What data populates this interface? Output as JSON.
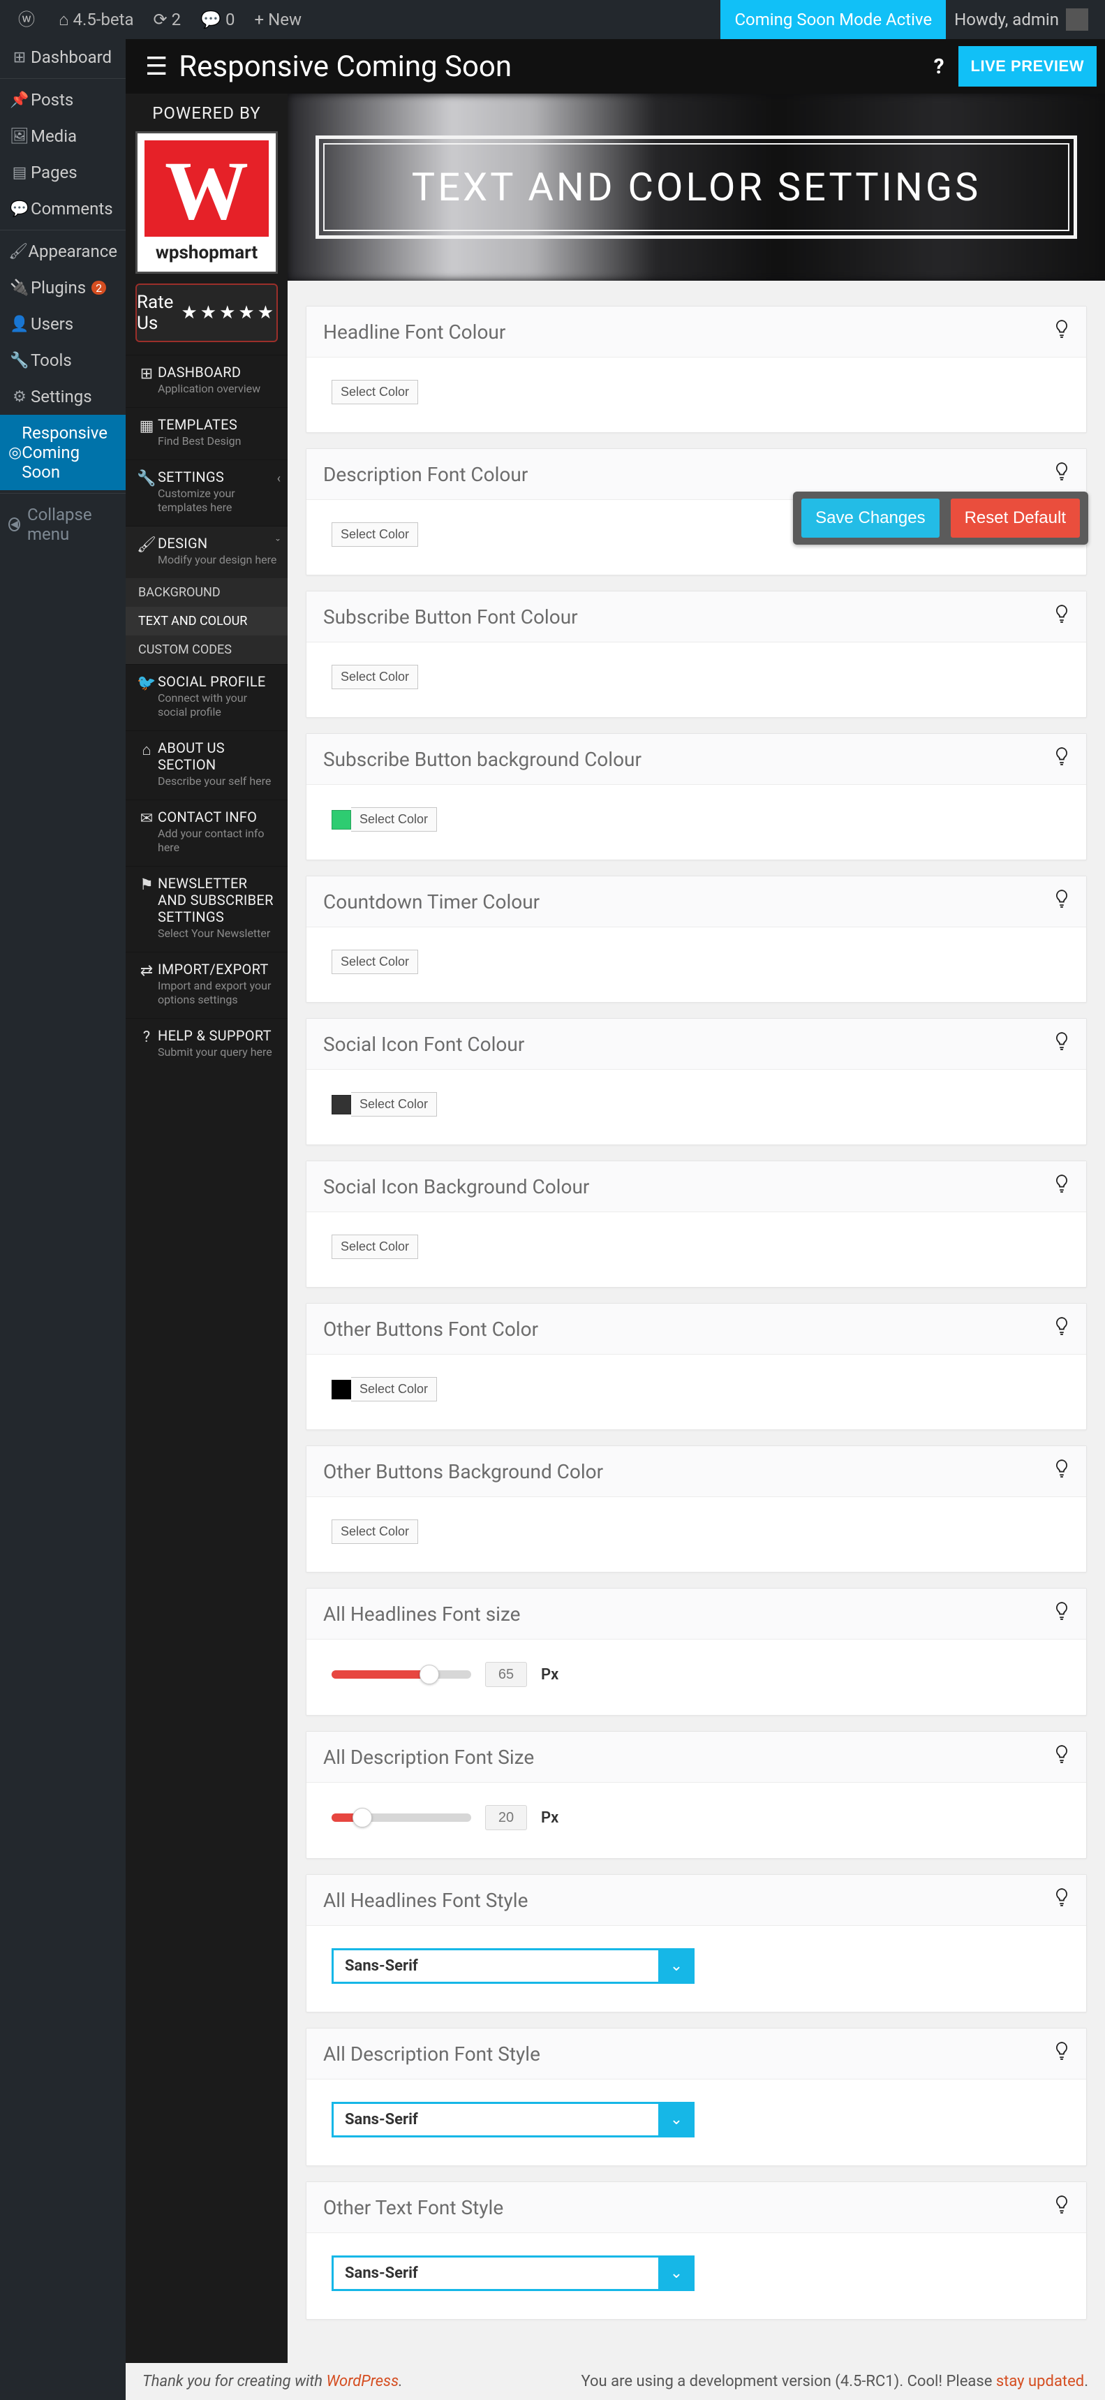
{
  "adminbar": {
    "site_name": "4.5-beta",
    "updates": "2",
    "comments": "0",
    "new": "New",
    "coming_soon": "Coming Soon Mode Active",
    "howdy": "Howdy, admin"
  },
  "wp_menu": {
    "dashboard": "Dashboard",
    "posts": "Posts",
    "media": "Media",
    "pages": "Pages",
    "comments": "Comments",
    "appearance": "Appearance",
    "plugins": "Plugins",
    "plugins_count": "2",
    "users": "Users",
    "tools": "Tools",
    "settings": "Settings",
    "rcs": "Responsive Coming Soon",
    "collapse": "Collapse menu"
  },
  "plugin": {
    "title": "Responsive Coming Soon",
    "preview_btn": "LIVE PREVIEW",
    "powered_by": "POWERED BY",
    "brand": "wpshopmart",
    "rate_us": "Rate Us",
    "hero_title": "TEXT AND COLOR SETTINGS",
    "save": "Save Changes",
    "reset": "Reset Default"
  },
  "plugin_menu": {
    "dashboard": {
      "t": "DASHBOARD",
      "s": "Application overview"
    },
    "templates": {
      "t": "TEMPLATES",
      "s": "Find Best Design"
    },
    "settings": {
      "t": "SETTINGS",
      "s": "Customize your templates here"
    },
    "design": {
      "t": "DESIGN",
      "s": "Modify your design here"
    },
    "design_title": "DESIGN",
    "design_sub1": "BACKGROUND",
    "design_sub2": "TEXT AND COLOUR",
    "design_sub3": "CUSTOM CODES",
    "social": {
      "t": "SOCIAL PROFILE",
      "s": "Connect with your social profile"
    },
    "about": {
      "t": "ABOUT US SECTION",
      "s": "Describe your self here"
    },
    "contact": {
      "t": "CONTACT INFO",
      "s": "Add your contact info here"
    },
    "newsletter": {
      "t": "NEWSLETTER AND SUBSCRIBER SETTINGS",
      "s": "Select Your Newsletter"
    },
    "import": {
      "t": "IMPORT/EXPORT",
      "s": "Import and export your options settings"
    },
    "help": {
      "t": "HELP & SUPPORT",
      "s": "Submit your query here"
    }
  },
  "cards": [
    {
      "label": "Headline Font Colour",
      "type": "color",
      "swatch": null,
      "btn": "Select Color"
    },
    {
      "label": "Description Font Colour",
      "type": "color",
      "swatch": null,
      "btn": "Select Color"
    },
    {
      "label": "Subscribe Button Font Colour",
      "type": "color",
      "swatch": null,
      "btn": "Select Color"
    },
    {
      "label": "Subscribe Button background Colour",
      "type": "color",
      "swatch": "#2ecc71",
      "btn": "Select Color"
    },
    {
      "label": "Countdown Timer Colour",
      "type": "color",
      "swatch": null,
      "btn": "Select Color"
    },
    {
      "label": "Social Icon Font Colour",
      "type": "color",
      "swatch": "#333333",
      "btn": "Select Color"
    },
    {
      "label": "Social Icon Background Colour",
      "type": "color",
      "swatch": null,
      "btn": "Select Color"
    },
    {
      "label": "Other Buttons Font Color",
      "type": "color",
      "swatch": "#000000",
      "btn": "Select Color"
    },
    {
      "label": "Other Buttons Background Color",
      "type": "color",
      "swatch": null,
      "btn": "Select Color"
    },
    {
      "label": "All Headlines Font size",
      "type": "slider",
      "value": "65",
      "percent": 70,
      "unit": "Px"
    },
    {
      "label": "All Description Font Size",
      "type": "slider",
      "value": "20",
      "percent": 22,
      "unit": "Px"
    },
    {
      "label": "All Headlines Font Style",
      "type": "select",
      "value": "Sans-Serif"
    },
    {
      "label": "All Description Font Style",
      "type": "select",
      "value": "Sans-Serif"
    },
    {
      "label": "Other Text Font Style",
      "type": "select",
      "value": "Sans-Serif"
    }
  ],
  "footer": {
    "thank": "Thank you for creating with ",
    "wp": "WordPress",
    "dot": ".",
    "ver_left": "You are using a development version (4.5-RC1). Cool! Please ",
    "stay": "stay updated",
    "ver_right": "."
  }
}
